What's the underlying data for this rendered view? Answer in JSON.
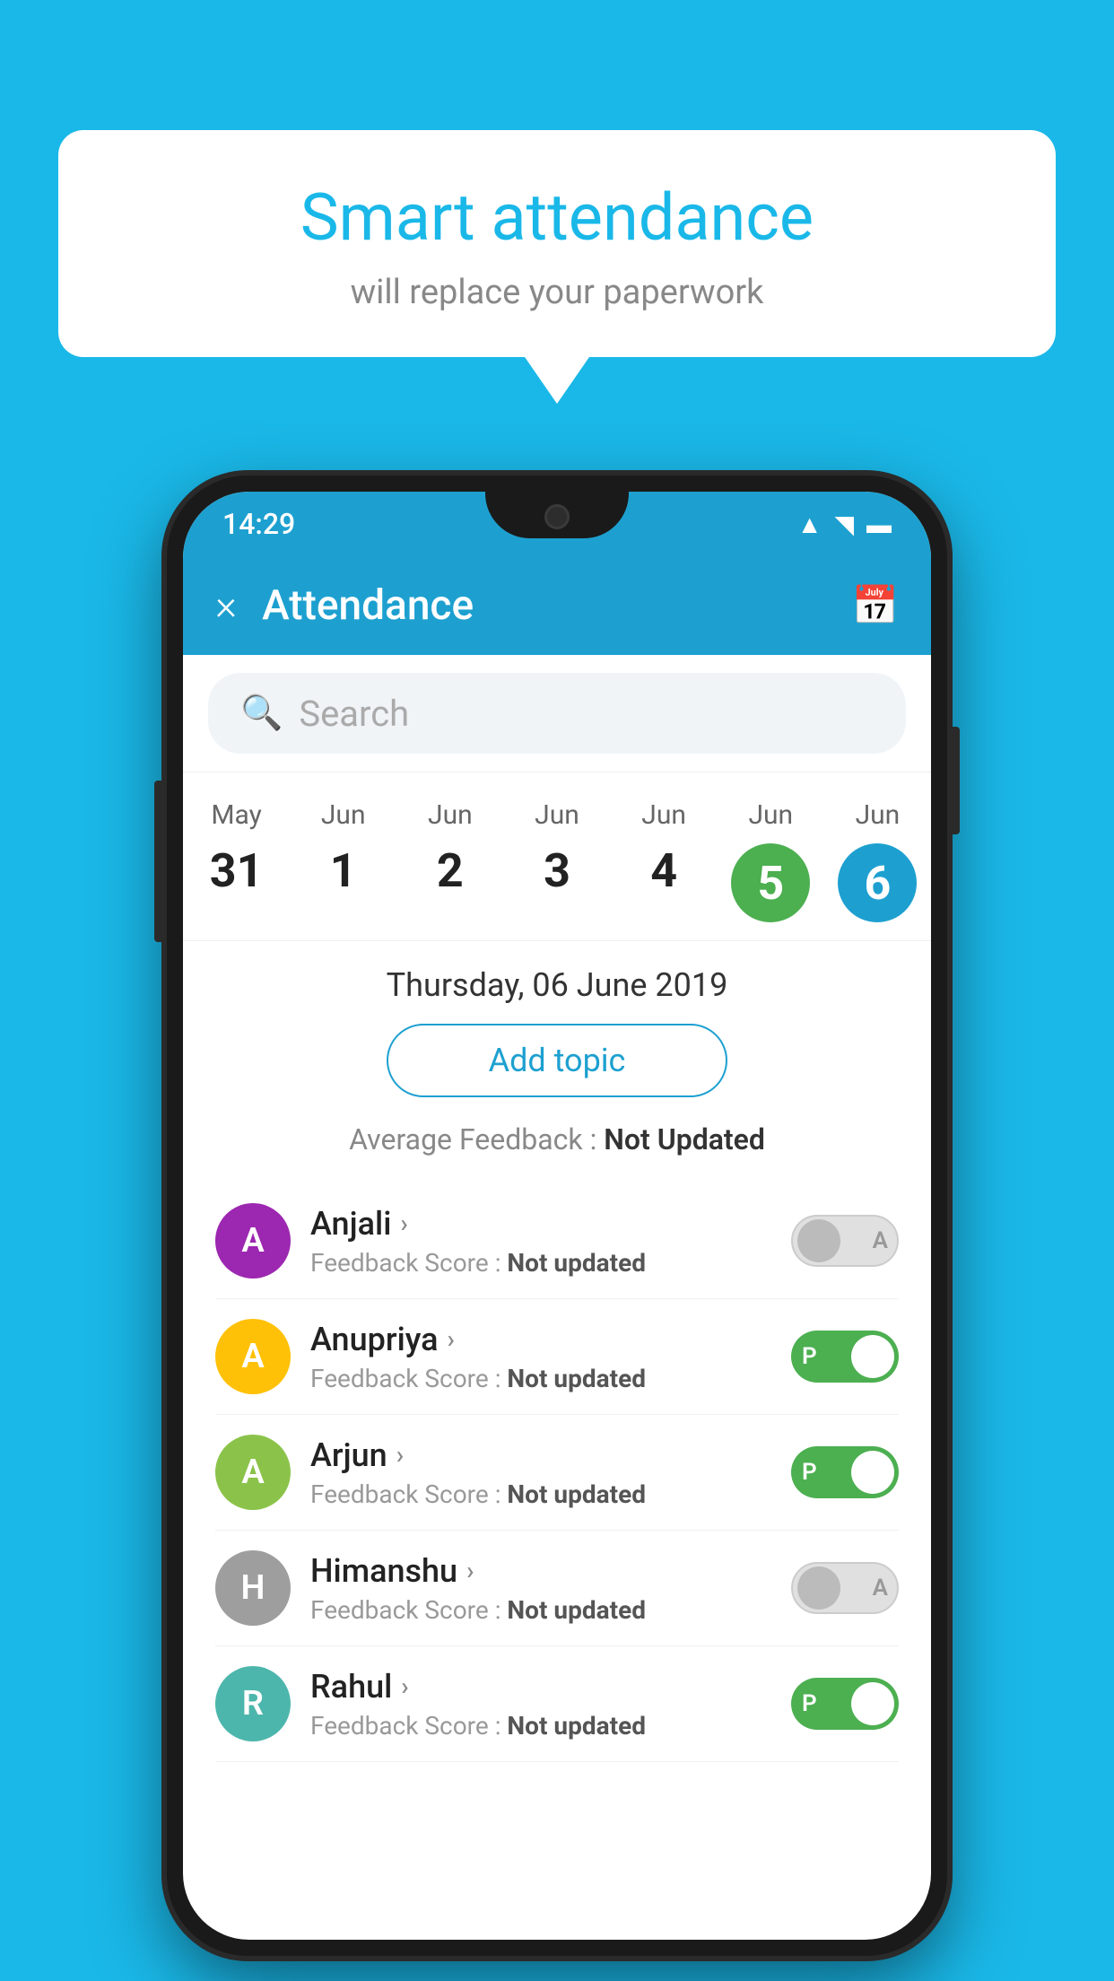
{
  "background_color": "#1ab8e8",
  "speech_bubble": {
    "title": "Smart attendance",
    "subtitle": "will replace your paperwork"
  },
  "status_bar": {
    "time": "14:29",
    "icons": [
      "wifi",
      "signal",
      "battery"
    ]
  },
  "app_bar": {
    "close_label": "×",
    "title": "Attendance",
    "calendar_icon": "📅"
  },
  "search": {
    "placeholder": "Search"
  },
  "date_strip": [
    {
      "month": "May",
      "day": "31",
      "state": "normal"
    },
    {
      "month": "Jun",
      "day": "1",
      "state": "normal"
    },
    {
      "month": "Jun",
      "day": "2",
      "state": "normal"
    },
    {
      "month": "Jun",
      "day": "3",
      "state": "normal"
    },
    {
      "month": "Jun",
      "day": "4",
      "state": "normal"
    },
    {
      "month": "Jun",
      "day": "5",
      "state": "today"
    },
    {
      "month": "Jun",
      "day": "6",
      "state": "selected"
    }
  ],
  "selected_date_label": "Thursday, 06 June 2019",
  "add_topic_label": "Add topic",
  "avg_feedback_label": "Average Feedback :",
  "avg_feedback_value": "Not Updated",
  "students": [
    {
      "name": "Anjali",
      "avatar_letter": "A",
      "avatar_color": "#9c27b0",
      "feedback_label": "Feedback Score :",
      "feedback_value": "Not updated",
      "toggle": "absent"
    },
    {
      "name": "Anupriya",
      "avatar_letter": "A",
      "avatar_color": "#ffc107",
      "feedback_label": "Feedback Score :",
      "feedback_value": "Not updated",
      "toggle": "present"
    },
    {
      "name": "Arjun",
      "avatar_letter": "A",
      "avatar_color": "#8bc34a",
      "feedback_label": "Feedback Score :",
      "feedback_value": "Not updated",
      "toggle": "present"
    },
    {
      "name": "Himanshu",
      "avatar_letter": "H",
      "avatar_color": "#9e9e9e",
      "feedback_label": "Feedback Score :",
      "feedback_value": "Not updated",
      "toggle": "absent"
    },
    {
      "name": "Rahul",
      "avatar_letter": "R",
      "avatar_color": "#4db6ac",
      "feedback_label": "Feedback Score :",
      "feedback_value": "Not updated",
      "toggle": "present"
    }
  ]
}
